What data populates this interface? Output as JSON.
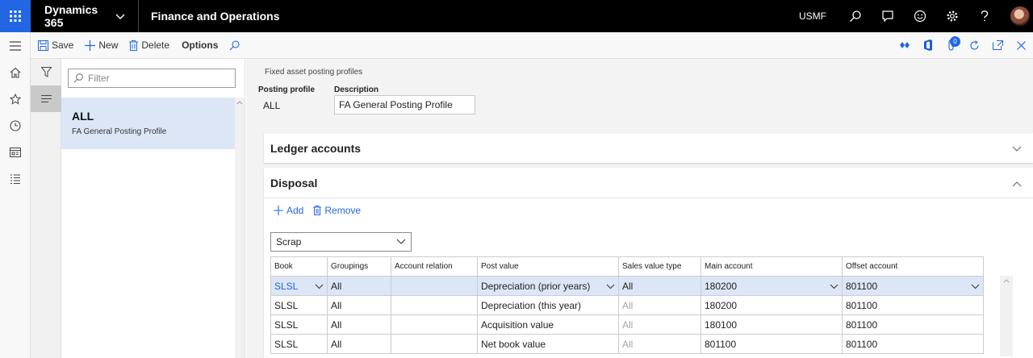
{
  "topbar": {
    "app_name": "Dynamics 365",
    "module_name": "Finance and Operations",
    "company": "USMF",
    "icons": [
      "waffle-icon",
      "search-icon",
      "chat-icon",
      "smiley-icon",
      "gear-icon",
      "help-icon"
    ]
  },
  "actions": {
    "save": "Save",
    "new": "New",
    "delete": "Delete",
    "options": "Options",
    "badge_count": "0"
  },
  "list": {
    "filter_placeholder": "Filter",
    "record_title": "ALL",
    "record_subtitle": "FA General Posting Profile"
  },
  "header": {
    "breadcrumb": "Fixed asset posting profiles",
    "posting_profile_label": "Posting profile",
    "posting_profile_value": "ALL",
    "description_label": "Description",
    "description_value": "FA General Posting Profile"
  },
  "sections": {
    "ledger": "Ledger accounts",
    "disposal": "Disposal"
  },
  "disposal": {
    "add": "Add",
    "remove": "Remove",
    "type_value": "Scrap",
    "columns": [
      "Book",
      "Groupings",
      "Account relation",
      "Post value",
      "Sales value type",
      "Main account",
      "Offset account"
    ],
    "rows": [
      [
        "SLSL",
        "All",
        "",
        "Depreciation (prior years)",
        "All",
        "180200",
        "801100"
      ],
      [
        "SLSL",
        "All",
        "",
        "Depreciation (this year)",
        "All",
        "180200",
        "801100"
      ],
      [
        "SLSL",
        "All",
        "",
        "Acquisition value",
        "All",
        "180100",
        "801100"
      ],
      [
        "SLSL",
        "All",
        "",
        "Net book value",
        "All",
        "801100",
        "801100"
      ]
    ]
  },
  "colors": {
    "accent": "#2266e3",
    "selected_row": "#dce6f6"
  }
}
